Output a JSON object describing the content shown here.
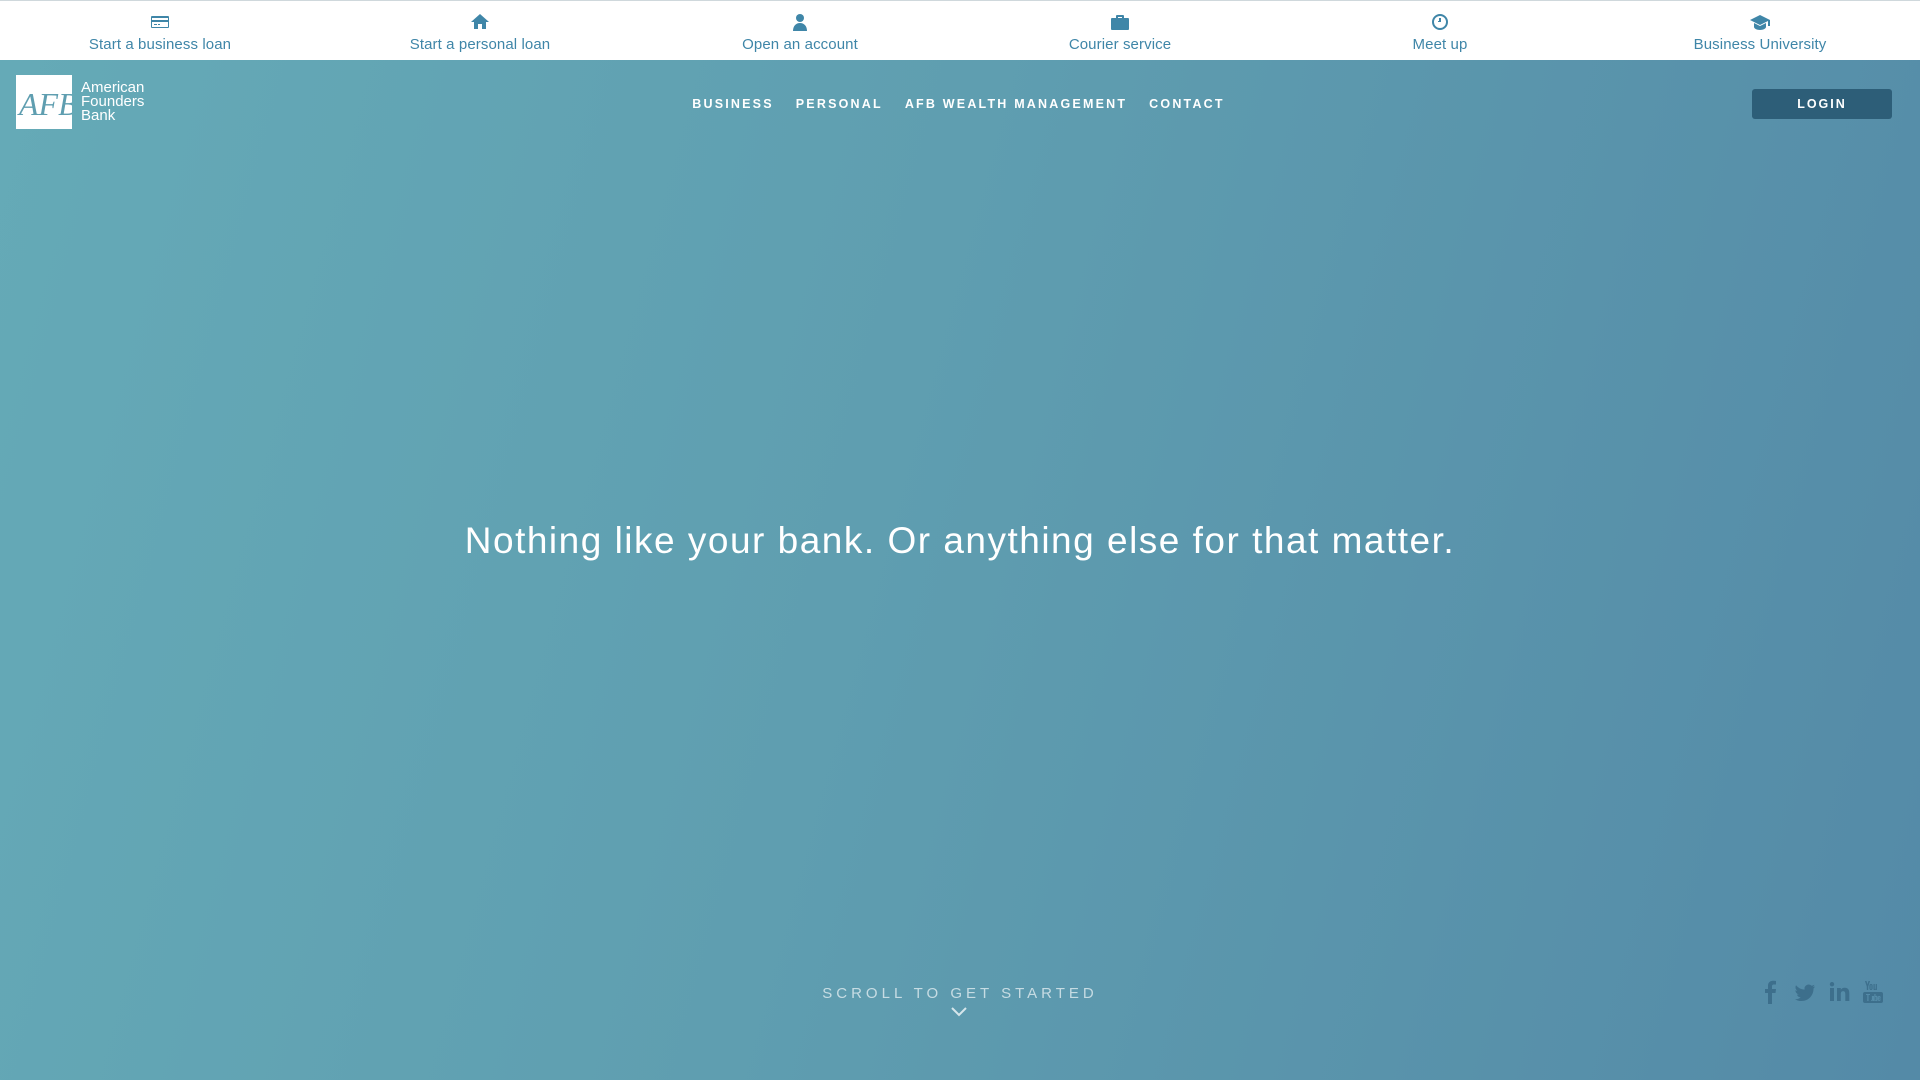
{
  "top_bar": {
    "items": [
      {
        "label": "Start a business loan",
        "icon": "credit-card-icon"
      },
      {
        "label": "Start a personal loan",
        "icon": "home-icon"
      },
      {
        "label": "Open an account",
        "icon": "user-icon"
      },
      {
        "label": "Courier service",
        "icon": "briefcase-icon"
      },
      {
        "label": "Meet up",
        "icon": "clock-icon"
      },
      {
        "label": "Business University",
        "icon": "graduation-cap-icon"
      }
    ]
  },
  "logo": {
    "mark": "AFB",
    "line1": "American",
    "line2": "Founders",
    "line3": "Bank"
  },
  "nav": {
    "items": [
      "BUSINESS",
      "PERSONAL",
      "AFB WEALTH MANAGEMENT",
      "CONTACT"
    ]
  },
  "login_label": "LOGIN",
  "hero": {
    "tagline": "Nothing like your bank. Or anything else for that matter.",
    "scroll_label": "SCROLL TO GET STARTED"
  },
  "social": [
    "facebook-icon",
    "twitter-icon",
    "linkedin-icon",
    "youtube-icon"
  ],
  "colors": {
    "accent": "#3f86a8",
    "hero_start": "#65aab7",
    "hero_end": "#548aa7",
    "login_bg": "#2d5e78",
    "social": "#3d6f8c"
  }
}
